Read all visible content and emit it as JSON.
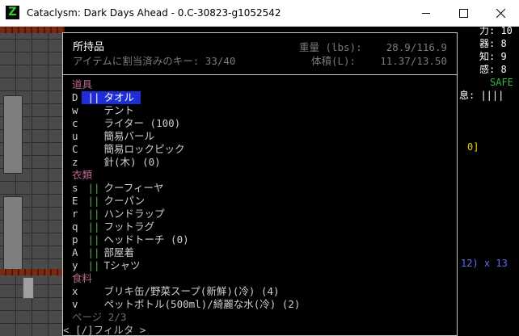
{
  "window": {
    "title": "Cataclysm: Dark Days Ahead - 0.C-30823-g1052542",
    "app_icon": "Z"
  },
  "sidebar": {
    "stats": [
      {
        "label": "力: 10"
      },
      {
        "label": "器: 8"
      },
      {
        "label": "知: 9"
      },
      {
        "label": "感: 8"
      }
    ],
    "safe": "SAFE",
    "rest_label": "息: ||||",
    "yellow_value": "0]",
    "blue_value": "12) x 13"
  },
  "inventory": {
    "title": "所持品",
    "assigned_keys": "アイテムに割当済みのキー: 33/40",
    "weight_label": "重量 (lbs):",
    "weight_value": "28.9/116.9",
    "volume_label": "体積(L):",
    "volume_value": "11.37/13.50",
    "rows": [
      {
        "type": "category",
        "label": "道具"
      },
      {
        "type": "item",
        "key": "D",
        "bars": "||",
        "label": "タオル",
        "selected": true
      },
      {
        "type": "item",
        "key": "w",
        "bars": "",
        "label": "テント"
      },
      {
        "type": "item",
        "key": "c",
        "bars": "",
        "label": "ライター (100)"
      },
      {
        "type": "item",
        "key": "u",
        "bars": "",
        "label": "簡易バール"
      },
      {
        "type": "item",
        "key": "C",
        "bars": "",
        "label": "簡易ロックピック"
      },
      {
        "type": "item",
        "key": "z",
        "bars": "",
        "label": "針(木) (0)"
      },
      {
        "type": "category",
        "label": "衣類"
      },
      {
        "type": "item",
        "key": "s",
        "bars": "||",
        "label": "クーフィーヤ"
      },
      {
        "type": "item",
        "key": "E",
        "bars": "||",
        "label": "クーパン"
      },
      {
        "type": "item",
        "key": "r",
        "bars": "||",
        "label": "ハンドラップ"
      },
      {
        "type": "item",
        "key": "q",
        "bars": "||",
        "label": "フットラグ"
      },
      {
        "type": "item",
        "key": "p",
        "bars": "||",
        "label": "ヘッドトーチ (0)"
      },
      {
        "type": "item",
        "key": "A",
        "bars": "||",
        "label": "部屋着"
      },
      {
        "type": "item",
        "key": "y",
        "bars": "||",
        "label": "Tシャツ"
      },
      {
        "type": "category",
        "label": "食料"
      },
      {
        "type": "item",
        "key": "x",
        "bars": "",
        "label": "ブリキ缶/野菜スープ(新鮮)(冷) (4)"
      },
      {
        "type": "item",
        "key": "v",
        "bars": "",
        "label": "ペットボトル(500ml)/綺麗な水(冷) (2)"
      },
      {
        "type": "page",
        "label": "ページ 2/3"
      },
      {
        "type": "footer",
        "label": "< [/]フィルタ >"
      }
    ]
  },
  "colors": {
    "category": "#b86a8c",
    "bars": "#3fbf3f",
    "selected_bg": "#1e2dd6",
    "green": "#39b54a",
    "yellow": "#e6d200",
    "blue": "#5c6cff"
  }
}
